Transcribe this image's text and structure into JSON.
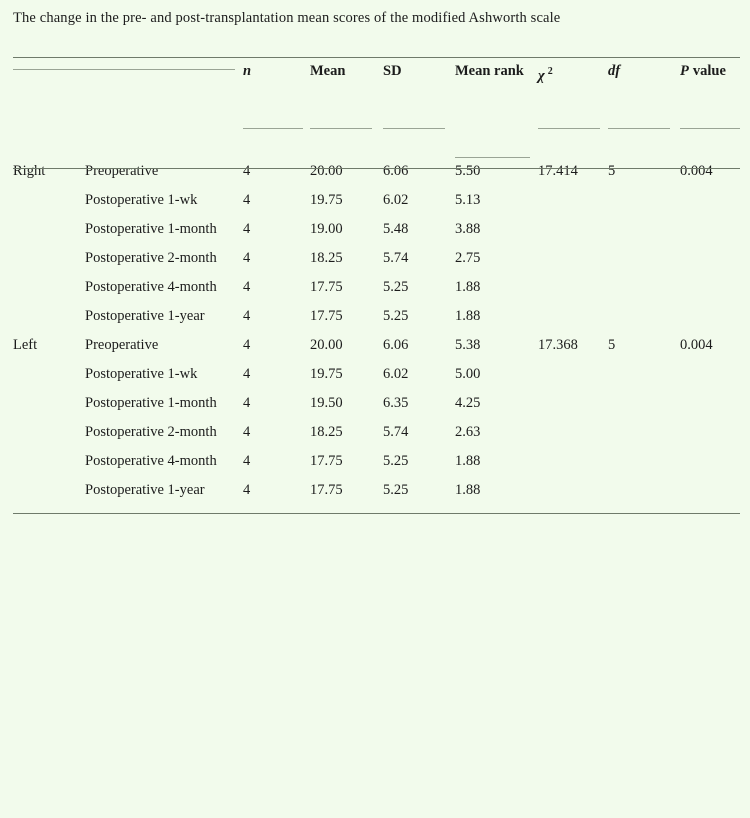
{
  "caption": "The change in the pre- and post-transplantation mean scores of the modified Ashworth scale",
  "colors": {
    "background": "#f2fbec",
    "text": "#1c1c1c",
    "rule_strong": "#6f7a6a",
    "rule_light": "#9aa495"
  },
  "table": {
    "headers": {
      "group": "",
      "timepoint": "",
      "n": "n",
      "mean": "Mean",
      "sd": "SD",
      "mean_rank": "Mean rank",
      "chi_square": "χ",
      "chi_square_sup": "2",
      "df": "df",
      "p_value_symbol": "P",
      "p_value_word": "value"
    },
    "rows": [
      {
        "group": "Right",
        "timepoint": "Preoperative",
        "n": "4",
        "mean": "20.00",
        "sd": "6.06",
        "mean_rank": "5.50",
        "chi_square": "17.414",
        "df": "5",
        "p_value": "0.004"
      },
      {
        "group": "",
        "timepoint": "Postoperative 1-wk",
        "n": "4",
        "mean": "19.75",
        "sd": "6.02",
        "mean_rank": "5.13",
        "chi_square": "",
        "df": "",
        "p_value": ""
      },
      {
        "group": "",
        "timepoint": "Postoperative 1-month",
        "n": "4",
        "mean": "19.00",
        "sd": "5.48",
        "mean_rank": "3.88",
        "chi_square": "",
        "df": "",
        "p_value": ""
      },
      {
        "group": "",
        "timepoint": "Postoperative 2-month",
        "n": "4",
        "mean": "18.25",
        "sd": "5.74",
        "mean_rank": "2.75",
        "chi_square": "",
        "df": "",
        "p_value": ""
      },
      {
        "group": "",
        "timepoint": "Postoperative 4-month",
        "n": "4",
        "mean": "17.75",
        "sd": "5.25",
        "mean_rank": "1.88",
        "chi_square": "",
        "df": "",
        "p_value": ""
      },
      {
        "group": "",
        "timepoint": "Postoperative 1-year",
        "n": "4",
        "mean": "17.75",
        "sd": "5.25",
        "mean_rank": "1.88",
        "chi_square": "",
        "df": "",
        "p_value": ""
      },
      {
        "group": "Left",
        "timepoint": "Preoperative",
        "n": "4",
        "mean": "20.00",
        "sd": "6.06",
        "mean_rank": "5.38",
        "chi_square": "17.368",
        "df": "5",
        "p_value": "0.004"
      },
      {
        "group": "",
        "timepoint": "Postoperative 1-wk",
        "n": "4",
        "mean": "19.75",
        "sd": "6.02",
        "mean_rank": "5.00",
        "chi_square": "",
        "df": "",
        "p_value": ""
      },
      {
        "group": "",
        "timepoint": "Postoperative 1-month",
        "n": "4",
        "mean": "19.50",
        "sd": "6.35",
        "mean_rank": "4.25",
        "chi_square": "",
        "df": "",
        "p_value": ""
      },
      {
        "group": "",
        "timepoint": "Postoperative 2-month",
        "n": "4",
        "mean": "18.25",
        "sd": "5.74",
        "mean_rank": "2.63",
        "chi_square": "",
        "df": "",
        "p_value": ""
      },
      {
        "group": "",
        "timepoint": "Postoperative 4-month",
        "n": "4",
        "mean": "17.75",
        "sd": "5.25",
        "mean_rank": "1.88",
        "chi_square": "",
        "df": "",
        "p_value": ""
      },
      {
        "group": "",
        "timepoint": "Postoperative 1-year",
        "n": "4",
        "mean": "17.75",
        "sd": "5.25",
        "mean_rank": "1.88",
        "chi_square": "",
        "df": "",
        "p_value": ""
      }
    ]
  }
}
